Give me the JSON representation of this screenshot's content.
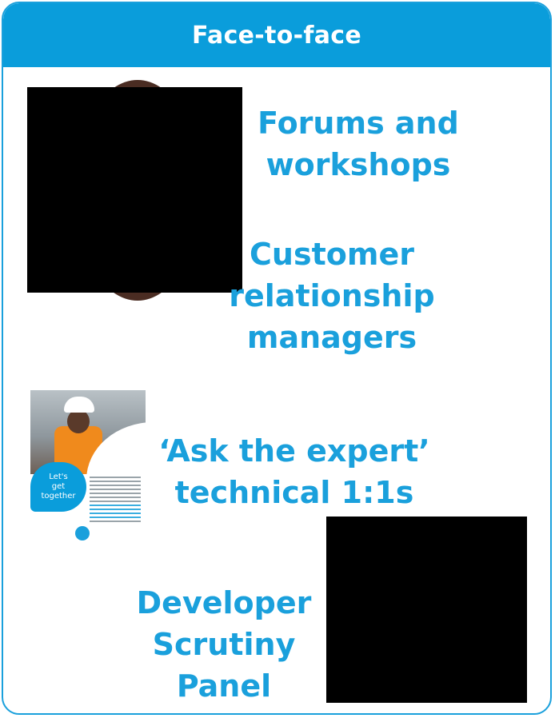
{
  "header": {
    "title": "Face-to-face"
  },
  "items": [
    {
      "lines": [
        "Forums and",
        "workshops"
      ]
    },
    {
      "lines": [
        "Customer",
        "relationship",
        "managers"
      ]
    },
    {
      "lines": [
        "‘Ask the expert’",
        "technical 1:1s"
      ]
    },
    {
      "lines": [
        "Developer",
        "Scrutiny",
        "Panel"
      ]
    }
  ],
  "flyer": {
    "bubble_lines": [
      "Let's",
      "get",
      "together"
    ]
  },
  "colors": {
    "accent": "#1aa0dc",
    "header_bg": "#0a9ddb"
  }
}
